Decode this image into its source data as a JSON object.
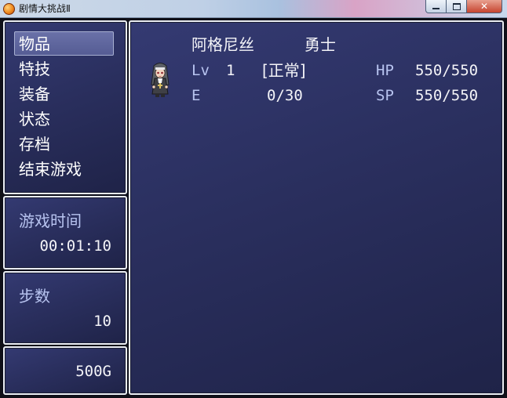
{
  "window": {
    "title": "剧情大挑战Ⅱ",
    "minimize_glyph": "",
    "maximize_glyph": "",
    "close_glyph": "✕"
  },
  "menu": {
    "items": [
      {
        "label": "物品",
        "selected": true
      },
      {
        "label": "特技",
        "selected": false
      },
      {
        "label": "装备",
        "selected": false
      },
      {
        "label": "状态",
        "selected": false
      },
      {
        "label": "存档",
        "selected": false
      },
      {
        "label": "结束游戏",
        "selected": false
      }
    ]
  },
  "playtime": {
    "label": "游戏时间",
    "value": "00:01:10"
  },
  "steps": {
    "label": "步数",
    "value": "10"
  },
  "gold": {
    "value": "500G"
  },
  "party": {
    "members": [
      {
        "name": "阿格尼丝",
        "class": "勇士",
        "level_label": "Lv",
        "level": "1",
        "state": "[正常]",
        "exp_label": "E",
        "exp": "0/30",
        "hp_label": "HP",
        "hp": "550/550",
        "sp_label": "SP",
        "sp": "550/550",
        "sprite_icon": "nun-character-sprite-icon"
      }
    ]
  },
  "colors": {
    "window_bg": "#2a2f5e",
    "window_border": "#e9ecf2",
    "system_text": "#b8c4f0",
    "normal_text": "#ffffff",
    "cursor": "#5f66a0"
  }
}
